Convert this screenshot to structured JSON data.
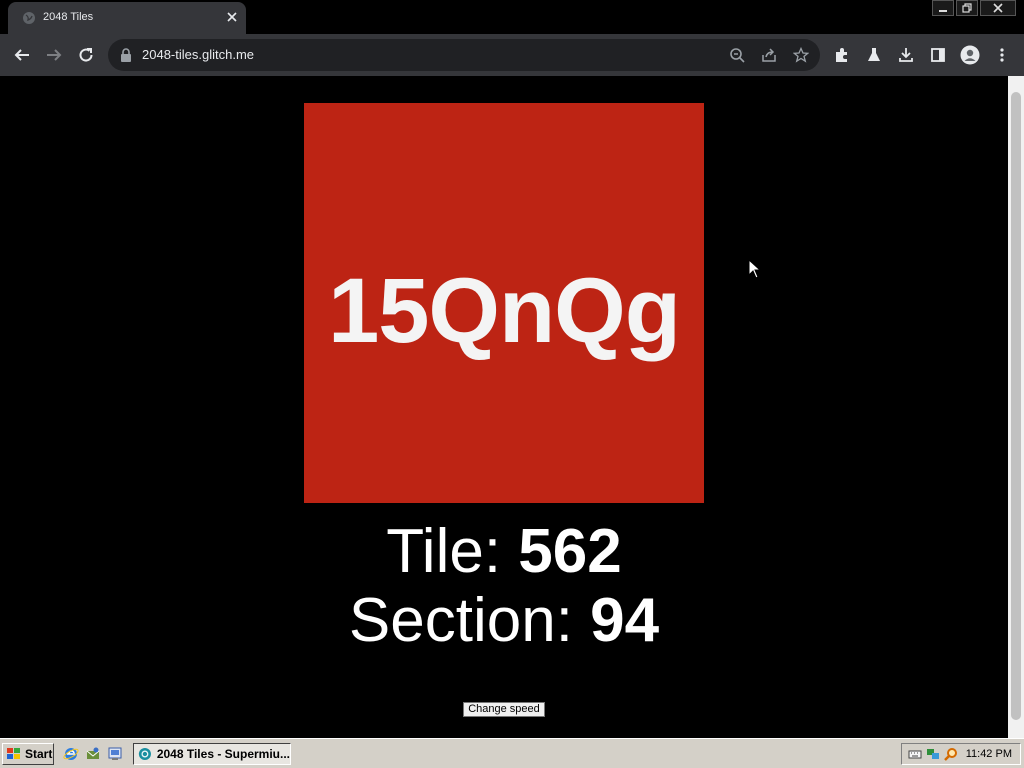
{
  "browser": {
    "tab": {
      "title": "2048 Tiles",
      "favicon": "globe-icon"
    },
    "url": "2048-tiles.glitch.me",
    "window_controls": [
      "minimize-icon",
      "restore-icon",
      "close-icon"
    ],
    "toolbar_icons": [
      "back-icon",
      "forward-icon",
      "reload-icon",
      "zoom-icon",
      "share-icon",
      "bookmark-star-icon",
      "extensions-icon",
      "labs-icon",
      "download-icon",
      "side-panel-icon",
      "profile-icon",
      "menu-icon"
    ]
  },
  "page": {
    "tile_text": "15QnQg",
    "tile_color": "#bd2414",
    "tile_label": "Tile: ",
    "tile_value": "562",
    "section_label": "Section: ",
    "section_value": "94",
    "speed_button": "Change speed"
  },
  "taskbar": {
    "start_label": "Start",
    "task_label": "2048 Tiles - Supermiu...",
    "clock": "11:42 PM"
  }
}
